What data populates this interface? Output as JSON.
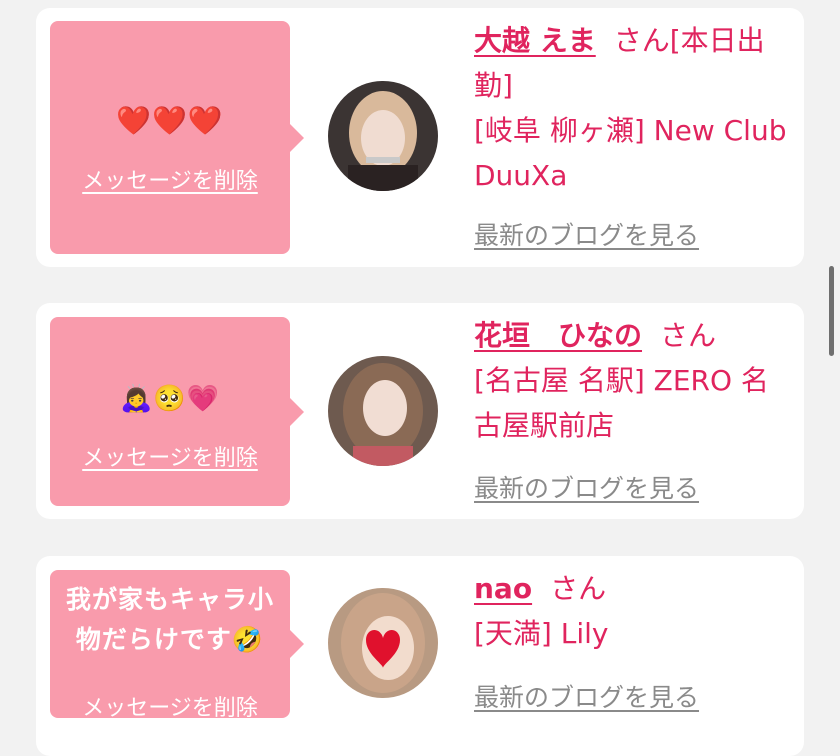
{
  "colors": {
    "accent_pink": "#e0245e",
    "bubble_pink": "#f99bac",
    "blog_link_gray": "#8a8a8a"
  },
  "cards": [
    {
      "message_icons": [
        "heart-emoji",
        "heart-emoji",
        "heart-emoji"
      ],
      "message_text": "❤️❤️❤️",
      "delete_label": "メッセージを削除",
      "name": "大越 えま",
      "suffix": "さん[本日出勤]",
      "location": "[岐阜 柳ヶ瀬] New Club DuuXa",
      "blog_label": "最新のブログを見る"
    },
    {
      "message_icons": [
        "person-bowing-emoji",
        "pleading-face-emoji",
        "growing-heart-emoji"
      ],
      "message_text": "🙇‍♀️🥺💗",
      "delete_label": "メッセージを削除",
      "name": "花垣　ひなの",
      "suffix": "さん",
      "location": "[名古屋 名駅] ZERO 名古屋駅前店",
      "blog_label": "最新のブログを見る"
    },
    {
      "message_icons": [
        "rolling-laughing-emoji"
      ],
      "message_text": "我が家もキャラ小物だらけです🤣",
      "delete_label": "メッセージを削除",
      "name": "nao",
      "suffix": "さん",
      "location": "[天満] Lily",
      "blog_label": "最新のブログを見る"
    }
  ]
}
